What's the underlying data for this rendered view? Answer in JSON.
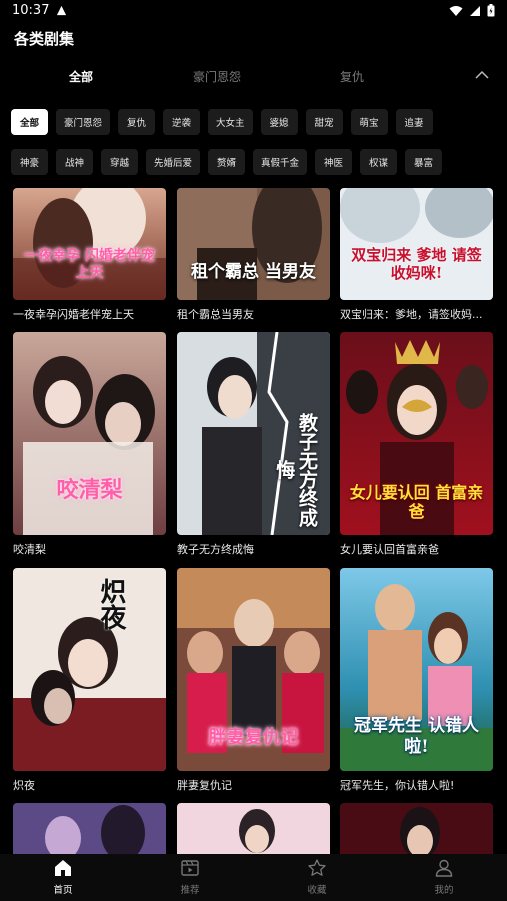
{
  "status_bar": {
    "time": "10:37"
  },
  "header": {
    "title": "各类剧集"
  },
  "top_tabs": [
    {
      "label": "全部",
      "active": true
    },
    {
      "label": "豪门恩怨",
      "active": false
    },
    {
      "label": "复仇",
      "active": false
    }
  ],
  "chips_row1": [
    "全部",
    "豪门恩怨",
    "复仇",
    "逆袭",
    "大女主",
    "婆媳",
    "甜宠",
    "萌宝",
    "追妻"
  ],
  "chips_row2": [
    "神豪",
    "战神",
    "穿越",
    "先婚后爱",
    "赘婿",
    "真假千金",
    "神医",
    "权谋",
    "暴富"
  ],
  "active_chip": "全部",
  "dramas": [
    {
      "title": "一夜幸孕闪婚老伴宠上天",
      "poster_text": "一夜幸孕 闪婚老伴宠上天"
    },
    {
      "title": "租个霸总当男友",
      "poster_text": "租个霸总 当男友"
    },
    {
      "title": "双宝归来：爹地，请签收妈...",
      "poster_text": "双宝归来 爹地 请签收妈咪!"
    },
    {
      "title": "咬清梨",
      "poster_text": "咬清梨"
    },
    {
      "title": "教子无方终成悔",
      "poster_text": "教子无方终成悔"
    },
    {
      "title": "女儿要认回首富亲爸",
      "poster_text": "女儿要认回 首富亲爸"
    },
    {
      "title": "炽夜",
      "poster_text": "炽夜"
    },
    {
      "title": "胖妻复仇记",
      "poster_text": "胖妻复仇记"
    },
    {
      "title": "冠军先生，你认错人啦!",
      "poster_text": "冠军先生 认错人啦!"
    }
  ],
  "bottom_nav": [
    {
      "label": "首页",
      "icon": "home-icon",
      "active": true
    },
    {
      "label": "推荐",
      "icon": "film-icon",
      "active": false
    },
    {
      "label": "收藏",
      "icon": "star-icon",
      "active": false
    },
    {
      "label": "我的",
      "icon": "person-icon",
      "active": false
    }
  ]
}
